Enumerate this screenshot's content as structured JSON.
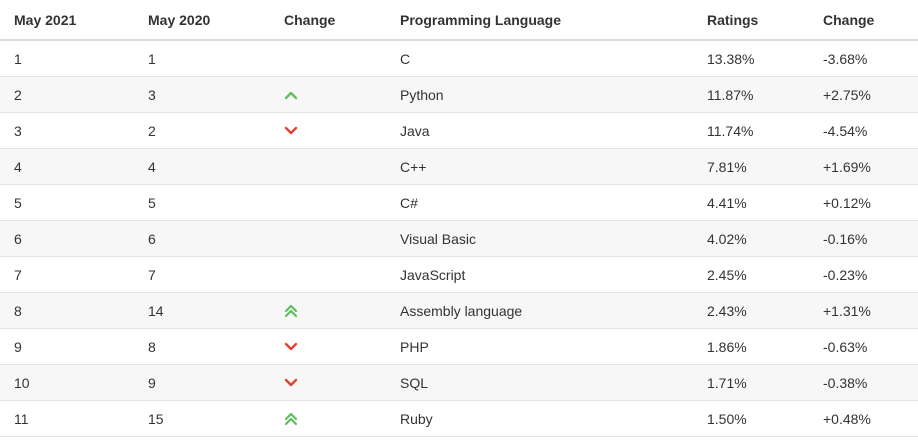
{
  "headers": [
    "May 2021",
    "May 2020",
    "Change",
    "Programming Language",
    "Ratings",
    "Change"
  ],
  "colors": {
    "up": "#5fbf5f",
    "down": "#e0442f"
  },
  "rows": [
    {
      "may2021": "1",
      "may2020": "1",
      "trend": "none",
      "language": "C",
      "rating": "13.38%",
      "change": "-3.68%"
    },
    {
      "may2021": "2",
      "may2020": "3",
      "trend": "up",
      "language": "Python",
      "rating": "11.87%",
      "change": "+2.75%"
    },
    {
      "may2021": "3",
      "may2020": "2",
      "trend": "down",
      "language": "Java",
      "rating": "11.74%",
      "change": "-4.54%"
    },
    {
      "may2021": "4",
      "may2020": "4",
      "trend": "none",
      "language": "C++",
      "rating": "7.81%",
      "change": "+1.69%"
    },
    {
      "may2021": "5",
      "may2020": "5",
      "trend": "none",
      "language": "C#",
      "rating": "4.41%",
      "change": "+0.12%"
    },
    {
      "may2021": "6",
      "may2020": "6",
      "trend": "none",
      "language": "Visual Basic",
      "rating": "4.02%",
      "change": "-0.16%"
    },
    {
      "may2021": "7",
      "may2020": "7",
      "trend": "none",
      "language": "JavaScript",
      "rating": "2.45%",
      "change": "-0.23%"
    },
    {
      "may2021": "8",
      "may2020": "14",
      "trend": "double-up",
      "language": "Assembly language",
      "rating": "2.43%",
      "change": "+1.31%"
    },
    {
      "may2021": "9",
      "may2020": "8",
      "trend": "down",
      "language": "PHP",
      "rating": "1.86%",
      "change": "-0.63%"
    },
    {
      "may2021": "10",
      "may2020": "9",
      "trend": "down",
      "language": "SQL",
      "rating": "1.71%",
      "change": "-0.38%"
    },
    {
      "may2021": "11",
      "may2020": "15",
      "trend": "double-up",
      "language": "Ruby",
      "rating": "1.50%",
      "change": "+0.48%"
    }
  ]
}
